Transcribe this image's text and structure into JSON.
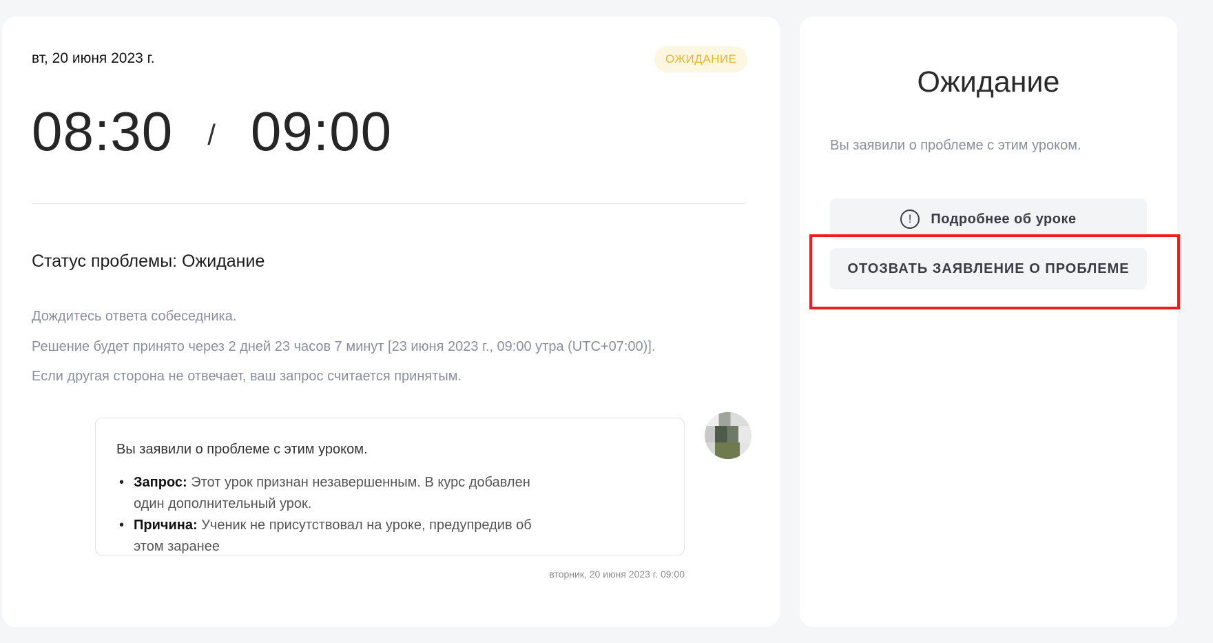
{
  "lesson": {
    "date": "вт, 20 июня 2023 г.",
    "status_badge": "ОЖИДАНИЕ",
    "start_time": "08:30",
    "separator": "/",
    "end_time": "09:00"
  },
  "problem": {
    "title": "Статус проблемы: Ожидание",
    "lines": [
      "Дождитесь ответа собеседника.",
      "Решение будет принято через 2 дней 23 часов 7 минут [23 июня 2023 г., 09:00 утра (UTC+07:00)].",
      "Если другая сторона не отвечает, ваш запрос считается принятым."
    ]
  },
  "message": {
    "intro": "Вы заявили о проблеме с этим уроком.",
    "items": [
      {
        "label": "Запрос:",
        "text": " Этот урок признан незавершенным. В курс добавлен один дополнительный урок."
      },
      {
        "label": "Причина:",
        "text": " Ученик не присутствовал на уроке, предупредив об этом заранее"
      }
    ],
    "timestamp": "вторник, 20 июня 2023 г. 09:00"
  },
  "sidebar": {
    "title": "Ожидание",
    "description": "Вы заявили о проблеме с этим уроком.",
    "details_button": "Подробнее об уроке",
    "withdraw_button": "ОТОЗВАТЬ ЗАЯВЛЕНИЕ О ПРОБЛЕМЕ"
  },
  "icons": {
    "info": "info-circle-icon",
    "bullet": "•"
  },
  "colors": {
    "status_badge_bg": "#fdf6e1",
    "status_badge_text": "#e9b523",
    "highlight": "#ee1c1c"
  }
}
